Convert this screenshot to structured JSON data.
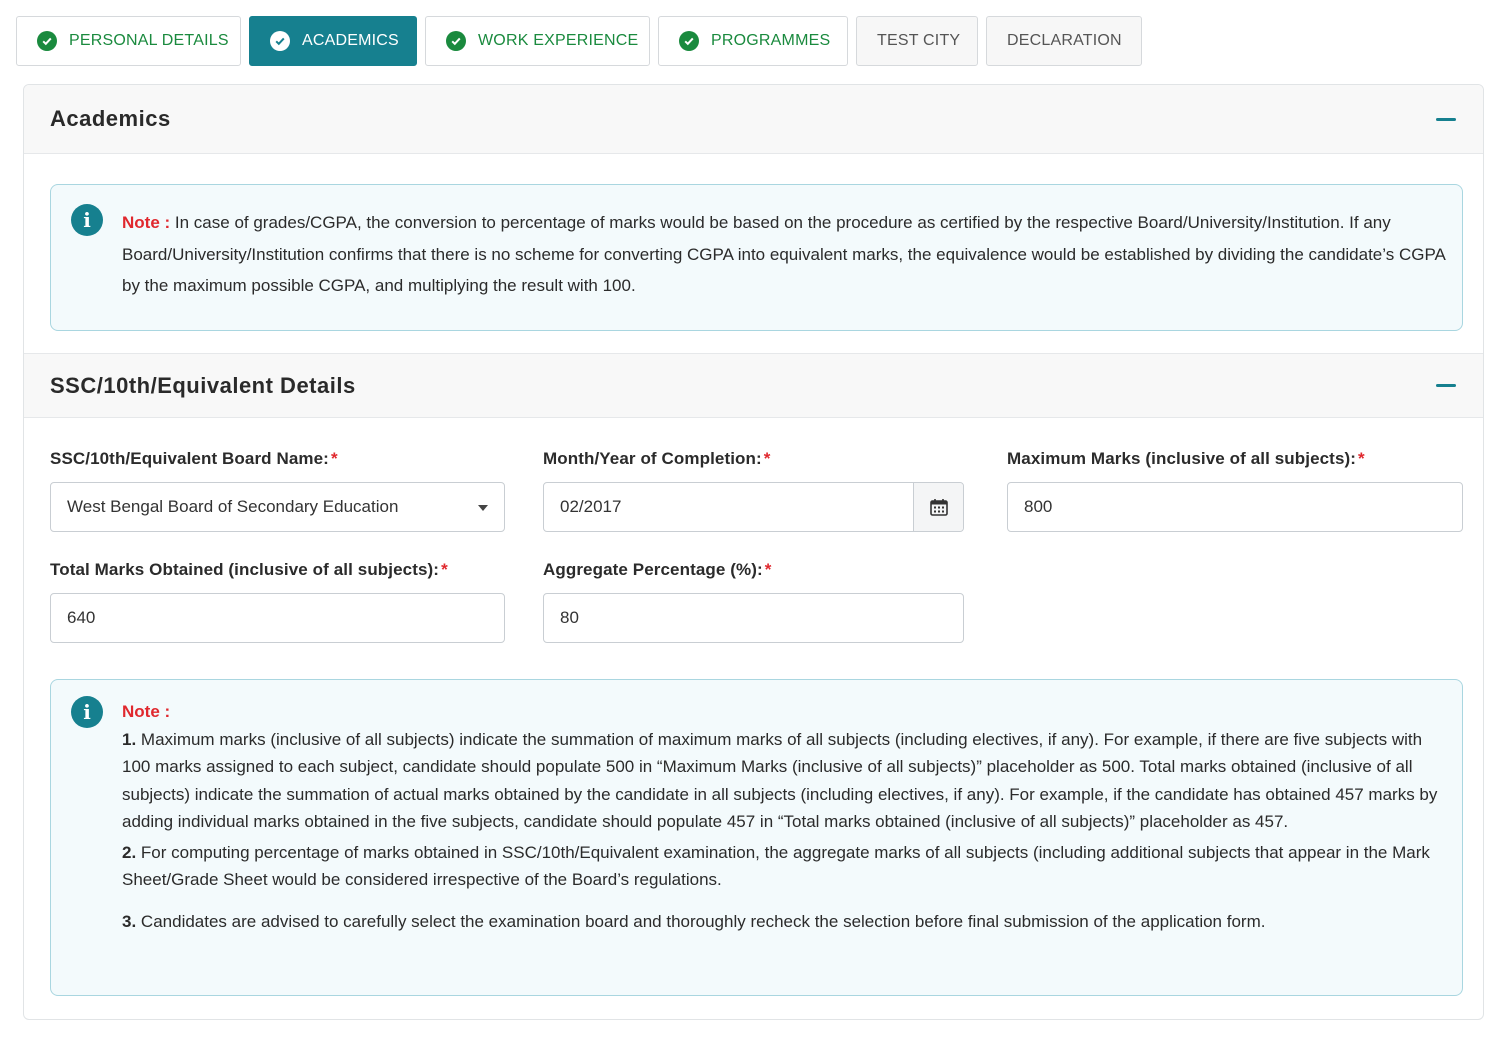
{
  "tabs": [
    {
      "label": "PERSONAL DETAILS",
      "state": "done"
    },
    {
      "label": "ACADEMICS",
      "state": "active"
    },
    {
      "label": "WORK EXPERIENCE",
      "state": "done"
    },
    {
      "label": "PROGRAMMES",
      "state": "done"
    },
    {
      "label": "TEST CITY",
      "state": "pending"
    },
    {
      "label": "DECLARATION",
      "state": "pending"
    }
  ],
  "section": {
    "title": "Academics"
  },
  "note_top": {
    "label": "Note :",
    "text": "In case of grades/CGPA, the conversion to percentage of marks would be based on the procedure as certified by the respective Board/University/Institution. If any Board/University/Institution confirms that there is no scheme for converting CGPA into equivalent marks, the equivalence would be established by dividing the candidate’s CGPA by the maximum possible CGPA, and multiplying the result with 100."
  },
  "ssc": {
    "title": "SSC/10th/Equivalent Details",
    "board_label": "SSC/10th/Equivalent Board Name:",
    "board_value": "West Bengal Board of Secondary Education",
    "month_label": "Month/Year of Completion:",
    "month_value": "02/2017",
    "max_label": "Maximum Marks (inclusive of all subjects):",
    "max_value": "800",
    "total_label": "Total Marks Obtained (inclusive of all subjects):",
    "total_value": "640",
    "agg_label": "Aggregate Percentage (%):",
    "agg_value": "80",
    "required_mark": "*"
  },
  "note_bottom": {
    "label": "Note :",
    "p1_num": "1.",
    "p1": "Maximum marks (inclusive of all subjects) indicate the summation of maximum marks of all subjects (including electives, if any). For example, if there are five subjects with 100 marks assigned to each subject, candidate should populate 500 in “Maximum Marks (inclusive of all subjects)” placeholder as 500. Total marks obtained (inclusive of all subjects) indicate the summation of actual marks obtained by the candidate in all subjects (including electives, if any). For example, if the candidate has obtained 457 marks by adding individual marks obtained in the five subjects, candidate should populate 457 in “Total marks obtained (inclusive of all subjects)” placeholder as 457.",
    "p2_num": "2.",
    "p2": "For computing percentage of marks obtained in SSC/10th/Equivalent examination, the aggregate marks of all subjects (including additional subjects that appear in the Mark Sheet/Grade Sheet would be considered irrespective of the Board’s regulations.",
    "p3_num": "3.",
    "p3": "Candidates are advised to carefully select the examination board and thoroughly recheck the selection before final submission of the application form."
  },
  "colors": {
    "accent": "#16808f",
    "done_green": "#1a8a3e",
    "required_red": "#e0282e"
  }
}
